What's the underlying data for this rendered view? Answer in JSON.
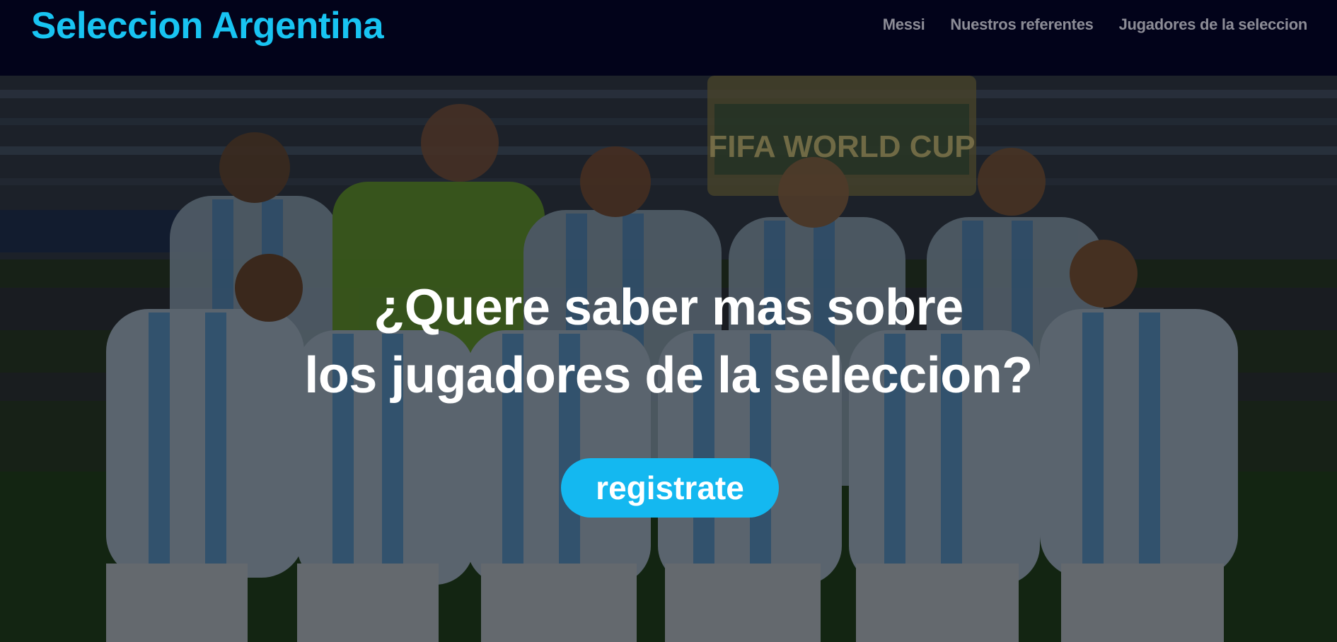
{
  "navbar": {
    "brand": "Seleccion Argentina",
    "links": [
      {
        "label": "Messi"
      },
      {
        "label": "Nuestros referentes"
      },
      {
        "label": "Jugadores de la seleccion"
      }
    ]
  },
  "hero": {
    "title_line1": "¿Quere saber mas sobre",
    "title_line2": "los jugadores de la seleccion?",
    "cta_label": "registrate",
    "background_image": "argentina-team-photo",
    "banner_text": "FIFA WORLD CUP"
  },
  "colors": {
    "navbar_bg": "#02031a",
    "brand": "#18c4f2",
    "nav_link": "#8c8c96",
    "cta_bg": "#14b8f0",
    "title": "#ffffff"
  }
}
